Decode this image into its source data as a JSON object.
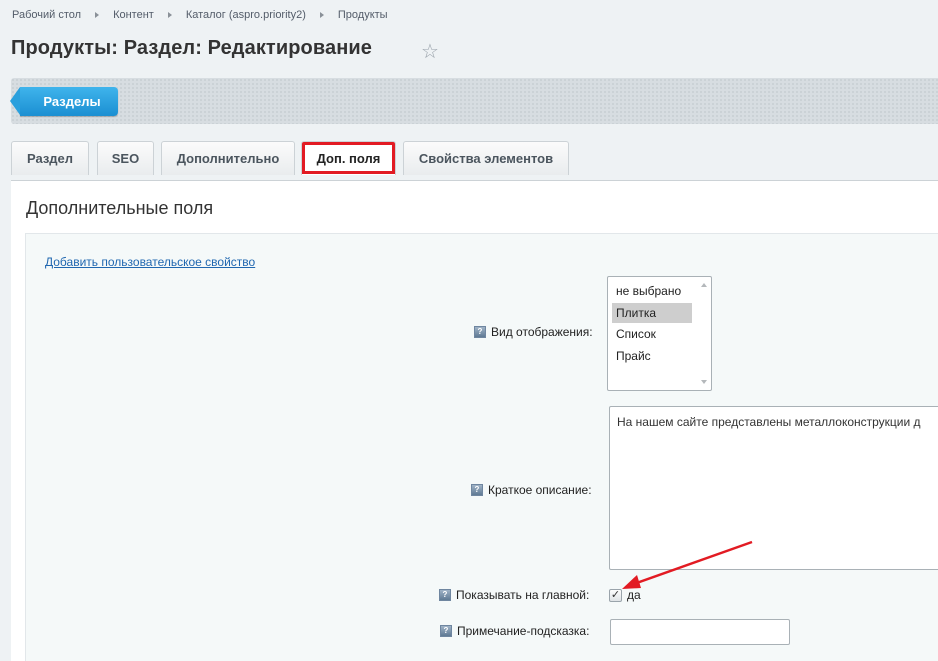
{
  "breadcrumb": [
    "Рабочий стол",
    "Контент",
    "Каталог (aspro.priority2)",
    "Продукты"
  ],
  "page": {
    "title": "Продукты: Раздел: Редактирование"
  },
  "toolbar": {
    "sections_button": "Разделы"
  },
  "tabs": [
    {
      "label": "Раздел"
    },
    {
      "label": "SEO"
    },
    {
      "label": "Дополнительно"
    },
    {
      "label": "Доп. поля",
      "active": true
    },
    {
      "label": "Свойства элементов"
    }
  ],
  "section": {
    "title": "Дополнительные поля",
    "add_link": "Добавить пользовательское свойство"
  },
  "fields": {
    "view_mode": {
      "label": "Вид отображения:",
      "options": [
        "не выбрано",
        "Плитка",
        "Список",
        "Прайс"
      ],
      "selected": "Плитка"
    },
    "short_description": {
      "label": "Краткое описание:",
      "value": "На нашем сайте представлены металлоконструкции д"
    },
    "show_on_main": {
      "label": "Показывать на главной:",
      "checked": true,
      "option_label": "да"
    },
    "hint_note": {
      "label": "Примечание-подсказка:",
      "value": ""
    }
  },
  "colors": {
    "accent_blue": "#1b8fd2",
    "highlight_red": "#e21b23"
  },
  "icons": {
    "favorite": "star-outline",
    "help": "question-square"
  }
}
